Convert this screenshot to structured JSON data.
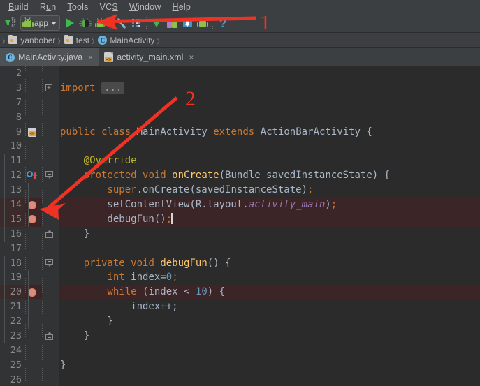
{
  "menu": {
    "items": [
      {
        "label": "Build",
        "mnemonic": "B"
      },
      {
        "label": "Run",
        "mnemonic": "u"
      },
      {
        "label": "Tools",
        "mnemonic": "T"
      },
      {
        "label": "VCS",
        "mnemonic": "S"
      },
      {
        "label": "Window",
        "mnemonic": "W"
      },
      {
        "label": "Help",
        "mnemonic": "H"
      }
    ]
  },
  "toolbar": {
    "sync_binary_lines": [
      "01",
      "10",
      "01"
    ],
    "run_config_label": "app",
    "icons": [
      {
        "name": "sync-gradle-icon",
        "title": "Sync Project with Gradle Files"
      },
      {
        "name": "run-icon",
        "title": "Run app"
      },
      {
        "name": "debug-icon",
        "title": "Debug app"
      },
      {
        "name": "attach-debugger-icon",
        "title": "Attach debugger to Android process"
      },
      {
        "name": "wrench-icon",
        "title": "Project Structure"
      },
      {
        "name": "layout-grid-icon",
        "title": "Layout Inspector"
      },
      {
        "name": "avd-download-icon",
        "title": "AVD Manager"
      },
      {
        "name": "sdk-manager-icon",
        "title": "SDK Manager"
      },
      {
        "name": "sdk-update-icon",
        "title": "SDK Update"
      },
      {
        "name": "android-device-icon",
        "title": "Device Monitor"
      },
      {
        "name": "help-icon",
        "title": "Help"
      }
    ],
    "help_glyph": "?"
  },
  "breadcrumb": {
    "items": [
      {
        "label": "yanbober",
        "icon": "folder-icon"
      },
      {
        "label": "test",
        "icon": "folder-icon"
      },
      {
        "label": "MainActivity",
        "icon": "class-icon",
        "glyph": "C"
      }
    ],
    "separator": "›"
  },
  "tabs": [
    {
      "label": "MainActivity.java",
      "icon": "java-class-icon",
      "glyph": "C",
      "active": true,
      "close": "×"
    },
    {
      "label": "activity_main.xml",
      "icon": "xml-file-icon",
      "active": false,
      "close": "×"
    }
  ],
  "editor": {
    "fold_placeholder": "...",
    "lines": [
      {
        "num": "2",
        "indent": 0,
        "segments": []
      },
      {
        "num": "3",
        "indent": 0,
        "fold": "plus",
        "segments": [
          {
            "t": "import",
            "c": "kw"
          },
          {
            "t": " ",
            "c": "pun"
          },
          {
            "t": "...",
            "c": "chip"
          }
        ]
      },
      {
        "num": "7",
        "indent": 0,
        "segments": []
      },
      {
        "num": "8",
        "indent": 0,
        "segments": []
      },
      {
        "num": "9",
        "indent": 0,
        "mark": "class-file-icon",
        "segments": [
          {
            "t": "public",
            "c": "kw"
          },
          {
            "t": " ",
            "c": "pun"
          },
          {
            "t": "class",
            "c": "kw"
          },
          {
            "t": " ",
            "c": "pun"
          },
          {
            "t": "MainActivity",
            "c": "cls"
          },
          {
            "t": " ",
            "c": "pun"
          },
          {
            "t": "extends",
            "c": "kw"
          },
          {
            "t": " ",
            "c": "pun"
          },
          {
            "t": "ActionBarActivity",
            "c": "cls"
          },
          {
            "t": " {",
            "c": "pun"
          }
        ]
      },
      {
        "num": "10",
        "indent": 0,
        "segments": []
      },
      {
        "num": "11",
        "indent": 1,
        "segments": [
          {
            "t": "    @Override",
            "c": "ann"
          }
        ]
      },
      {
        "num": "12",
        "indent": 1,
        "mark": "override-marker",
        "fold": "top",
        "segments": [
          {
            "t": "    ",
            "c": "pun"
          },
          {
            "t": "protected",
            "c": "kw"
          },
          {
            "t": " ",
            "c": "pun"
          },
          {
            "t": "void",
            "c": "kw"
          },
          {
            "t": " ",
            "c": "pun"
          },
          {
            "t": "onCreate",
            "c": "mth"
          },
          {
            "t": "(",
            "c": "pun"
          },
          {
            "t": "Bundle",
            "c": "cls"
          },
          {
            "t": " savedInstanceState) {",
            "c": "pun"
          }
        ]
      },
      {
        "num": "13",
        "indent": 2,
        "segments": [
          {
            "t": "        ",
            "c": "pun"
          },
          {
            "t": "super",
            "c": "kw"
          },
          {
            "t": ".onCreate(savedInstanceState)",
            "c": "pun"
          },
          {
            "t": ";",
            "c": "semi"
          }
        ]
      },
      {
        "num": "14",
        "indent": 2,
        "breakpoint": true,
        "highlight": true,
        "segments": [
          {
            "t": "        setContentView(R.layout.",
            "c": "pun"
          },
          {
            "t": "activity_main",
            "c": "fld"
          },
          {
            "t": ")",
            "c": "pun"
          },
          {
            "t": ";",
            "c": "semi"
          }
        ]
      },
      {
        "num": "15",
        "indent": 2,
        "breakpoint": true,
        "highlight": true,
        "caret": true,
        "segments": [
          {
            "t": "        debugFun()",
            "c": "pun"
          },
          {
            "t": ";",
            "c": "semi"
          }
        ]
      },
      {
        "num": "16",
        "indent": 1,
        "fold": "bottom",
        "segments": [
          {
            "t": "    }",
            "c": "pun"
          }
        ]
      },
      {
        "num": "17",
        "indent": 0,
        "segments": []
      },
      {
        "num": "18",
        "indent": 1,
        "fold": "top",
        "segments": [
          {
            "t": "    ",
            "c": "pun"
          },
          {
            "t": "private",
            "c": "kw"
          },
          {
            "t": " ",
            "c": "pun"
          },
          {
            "t": "void",
            "c": "kw"
          },
          {
            "t": " ",
            "c": "pun"
          },
          {
            "t": "debugFun",
            "c": "mth"
          },
          {
            "t": "() {",
            "c": "pun"
          }
        ]
      },
      {
        "num": "19",
        "indent": 2,
        "segments": [
          {
            "t": "        ",
            "c": "pun"
          },
          {
            "t": "int",
            "c": "kw"
          },
          {
            "t": " index=",
            "c": "pun"
          },
          {
            "t": "0",
            "c": "num"
          },
          {
            "t": ";",
            "c": "semi"
          }
        ]
      },
      {
        "num": "20",
        "indent": 2,
        "breakpoint": true,
        "highlight": true,
        "segments": [
          {
            "t": "        ",
            "c": "pun"
          },
          {
            "t": "while",
            "c": "kw"
          },
          {
            "t": " (index < ",
            "c": "pun"
          },
          {
            "t": "10",
            "c": "num"
          },
          {
            "t": ") {",
            "c": "pun"
          }
        ]
      },
      {
        "num": "21",
        "indent": 3,
        "segments": [
          {
            "t": "            index++;",
            "c": "pun"
          }
        ]
      },
      {
        "num": "22",
        "indent": 2,
        "segments": [
          {
            "t": "        }",
            "c": "pun"
          }
        ]
      },
      {
        "num": "23",
        "indent": 1,
        "fold": "bottom",
        "segments": [
          {
            "t": "    }",
            "c": "pun"
          }
        ]
      },
      {
        "num": "24",
        "indent": 0,
        "segments": []
      },
      {
        "num": "25",
        "indent": 0,
        "segments": [
          {
            "t": "}",
            "c": "pun"
          }
        ]
      },
      {
        "num": "26",
        "indent": 0,
        "segments": []
      }
    ]
  },
  "annotations": [
    {
      "name": "annotation-1",
      "label": "1",
      "desc": "red arrow pointing left to debug button"
    },
    {
      "name": "annotation-2",
      "label": "2",
      "desc": "red arrow pointing down-left to breakpoint gutter"
    }
  ],
  "colors": {
    "accent_red": "#f03224",
    "keyword": "#cc7832",
    "method": "#ffc66d",
    "number": "#6897bb",
    "annotation": "#bbb529",
    "field_italic": "#9876aa",
    "editor_bg": "#2b2b2b",
    "gutter_bg": "#313335",
    "chrome_bg": "#3c3f41",
    "breakpoint_row": "#3c2527",
    "breakpoint_dot": "#e08a7a"
  }
}
